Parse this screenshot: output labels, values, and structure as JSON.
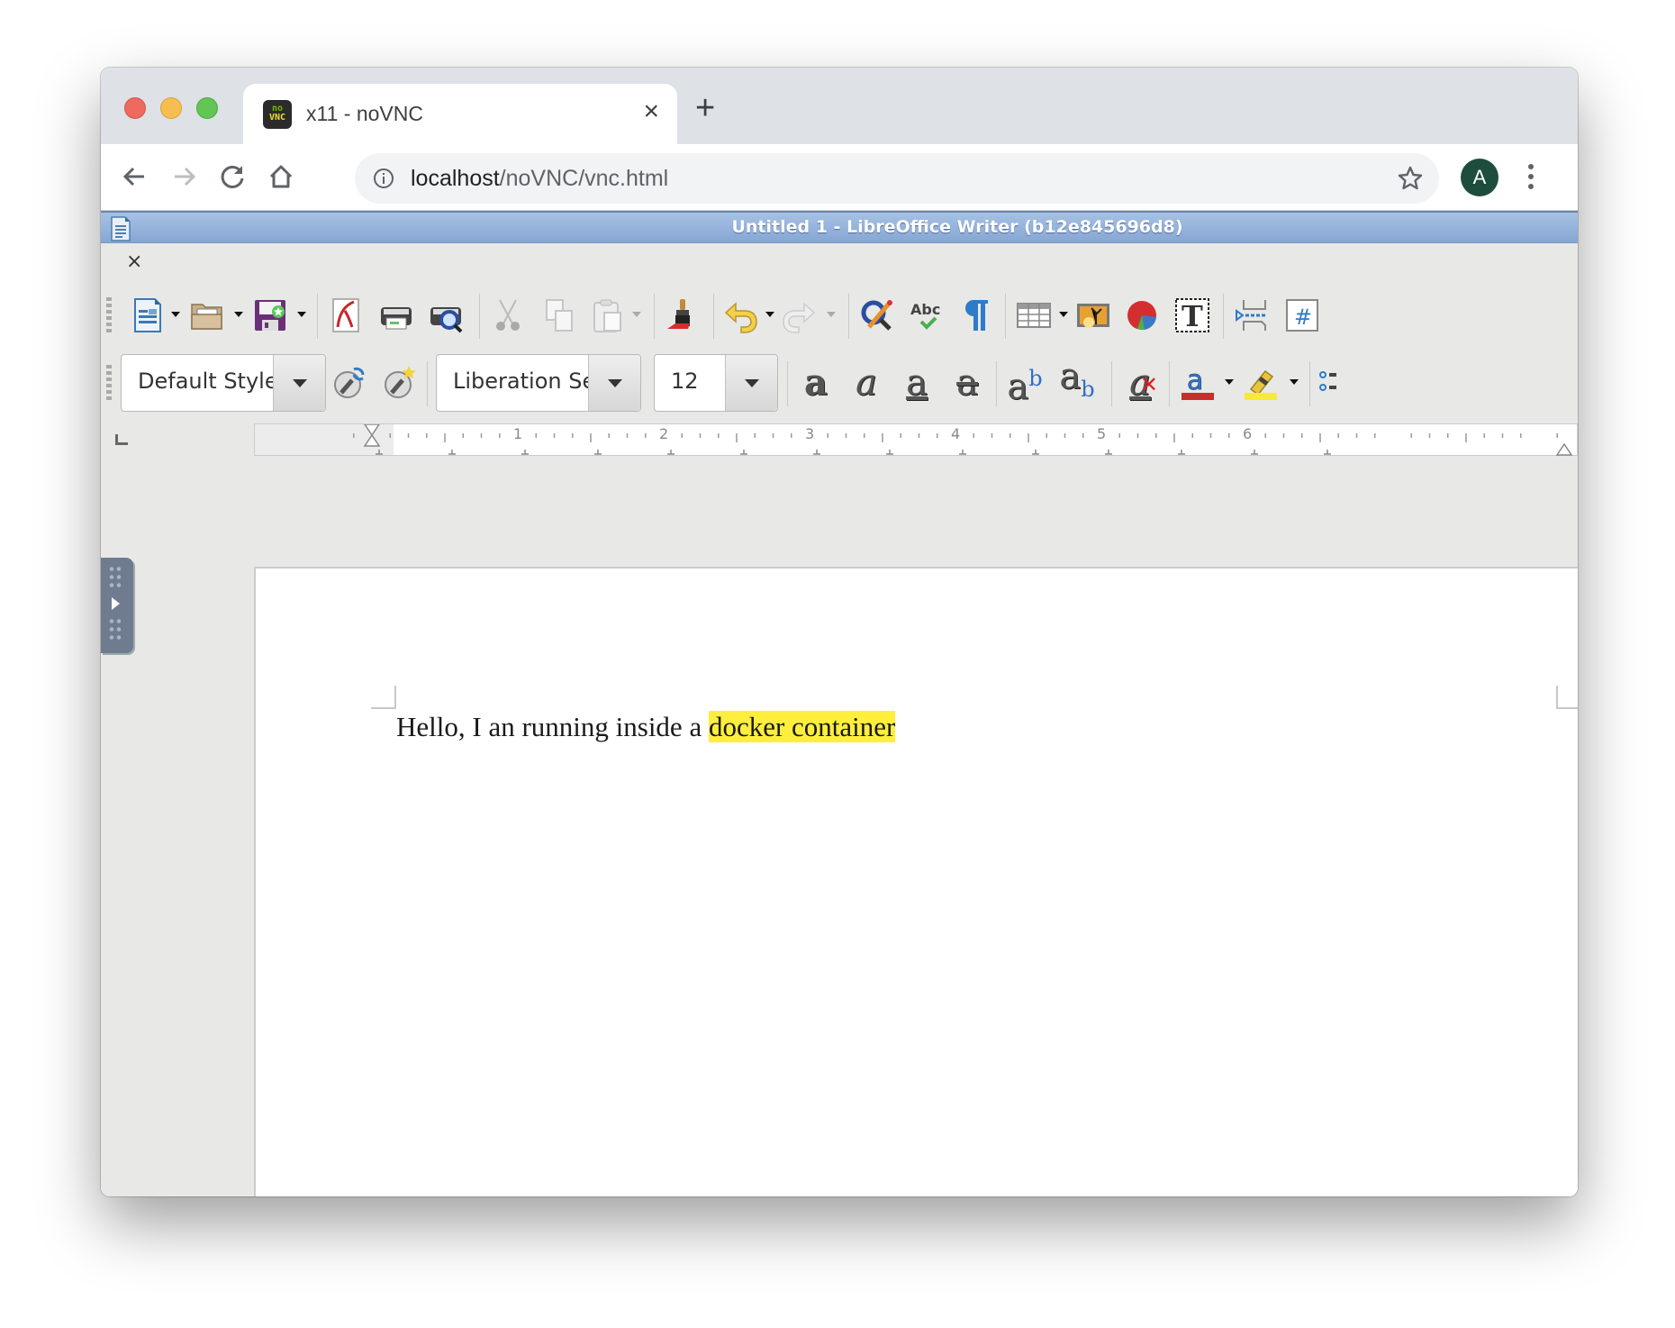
{
  "browser": {
    "tab": {
      "title": "x11 - noVNC",
      "favicon_line1": "no",
      "favicon_line2": "VNC"
    },
    "new_tab_label": "+",
    "close_tab_label": "×",
    "url_host": "localhost",
    "url_path": "/noVNC/vnc.html",
    "profile_initial": "A",
    "colors": {
      "avatar": "#1e4d3d",
      "tabstrip": "#dee1e6"
    }
  },
  "libreoffice": {
    "window_title": "Untitled 1 - LibreOffice Writer (b12e845696d8)",
    "doc_close_label": "×",
    "toolbar_standard": [
      "new-document",
      "open",
      "save",
      "export-pdf",
      "print",
      "print-preview",
      "cut",
      "copy",
      "paste",
      "clone-formatting",
      "undo",
      "redo",
      "find-replace",
      "spelling",
      "formatting-marks",
      "insert-table",
      "insert-image",
      "insert-chart",
      "insert-text-box",
      "insert-page-break",
      "insert-field"
    ],
    "paragraph_style": "Default Style",
    "font_name": "Liberation Se",
    "font_size": "12",
    "toolbar_formatting": [
      "update-style",
      "new-style",
      "bold",
      "italic",
      "underline",
      "strikethrough",
      "superscript",
      "subscript",
      "clear-formatting",
      "font-color",
      "highlight-color",
      "bullets"
    ],
    "formatting_glyphs": {
      "bold": "a",
      "italic": "a",
      "underline": "a",
      "strike": "a",
      "sup_base": "a",
      "sup": "b",
      "sub_base": "a",
      "sub": "b",
      "clear": "a"
    },
    "font_color": "#c7302a",
    "highlight_color": "#f7e93a",
    "ruler_labels": [
      "1",
      "2",
      "3",
      "4",
      "5",
      "6"
    ],
    "document": {
      "text_plain": "Hello, I an running inside a ",
      "text_highlighted": "docker container",
      "highlight_color": "#ffef3c"
    }
  }
}
